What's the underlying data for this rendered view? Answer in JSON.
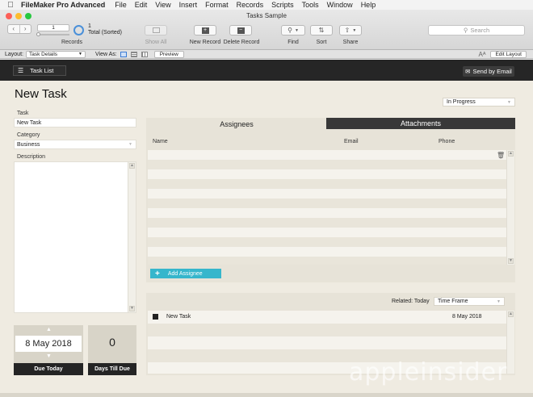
{
  "menubar": {
    "app_name": "FileMaker Pro Advanced",
    "items": [
      "File",
      "Edit",
      "View",
      "Insert",
      "Format",
      "Records",
      "Scripts",
      "Tools",
      "Window",
      "Help"
    ]
  },
  "window": {
    "title": "Tasks Sample"
  },
  "toolbar": {
    "record_number": "1",
    "total_count": "1",
    "total_sorted": "Total (Sorted)",
    "records_label": "Records",
    "show_all_label": "Show All",
    "new_record_label": "New Record",
    "delete_record_label": "Delete Record",
    "find_label": "Find",
    "sort_label": "Sort",
    "share_label": "Share",
    "search_placeholder": "Search"
  },
  "layoutbar": {
    "layout_label": "Layout:",
    "layout_value": "Task Details",
    "view_as_label": "View As:",
    "preview_label": "Preview",
    "edit_layout_label": "Edit Layout"
  },
  "header": {
    "task_list_label": "Task List",
    "send_email_label": "Send by Email"
  },
  "form": {
    "page_title": "New Task",
    "status_value": "In Progress",
    "task_label": "Task",
    "task_value": "New Task",
    "category_label": "Category",
    "category_value": "Business",
    "description_label": "Description",
    "due_date": "8 May 2018",
    "due_label": "Due Today",
    "days_till_due": "0",
    "days_till_due_label": "Days Till Due"
  },
  "tabs": {
    "assignees_label": "Assignees",
    "attachments_label": "Attachments"
  },
  "assignees": {
    "columns": [
      "Name",
      "Email",
      "Phone"
    ],
    "add_label": "Add Assignee"
  },
  "related": {
    "filter_label": "Related: Today",
    "filter_value": "Time Frame",
    "rows": [
      {
        "name": "New Task",
        "date": "8 May 2018"
      }
    ]
  },
  "watermark": "appleinsider",
  "colors": {
    "accent_button": "#36b6cc",
    "dark_bar": "#262626",
    "content_bg": "#efebe1"
  }
}
